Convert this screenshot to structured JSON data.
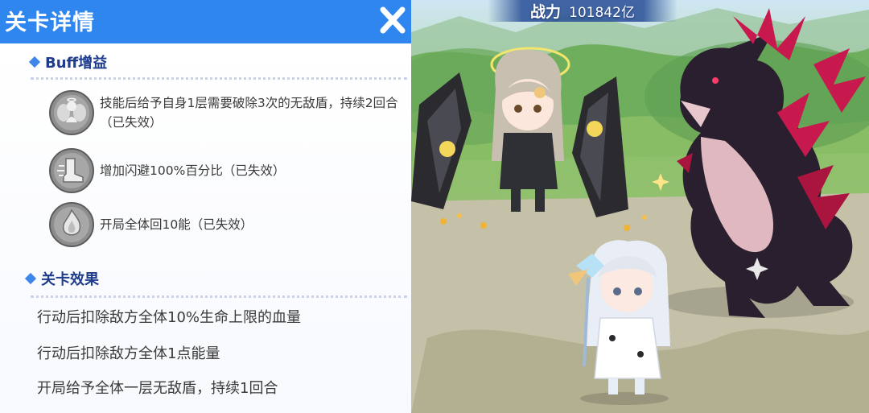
{
  "panel": {
    "title": "关卡详情",
    "buff_section": {
      "title": "Buff增益",
      "items": [
        {
          "icon": "angel-icon",
          "text": "技能后给予自身1层需要破除3次的无敌盾，持续2回合（已失效）"
        },
        {
          "icon": "boot-icon",
          "text": "增加闪避100%百分比（已失效）"
        },
        {
          "icon": "energy-flame-icon",
          "text": "开局全体回10能（已失效）"
        }
      ]
    },
    "effect_section": {
      "title": "关卡效果",
      "items": [
        "行动后扣除敌方全体10%生命上限的血量",
        "行动后扣除敌方全体1点能量",
        "开局给予全体一层无敌盾，持续1回合"
      ]
    }
  },
  "scene": {
    "power_label": "战力",
    "power_value": "101842亿"
  },
  "colors": {
    "header_blue": "#2f86ee",
    "section_title": "#1f3c8c",
    "diamond": "#3f86ea",
    "body_text": "#3a3a3a",
    "dragon_accent": "#c8194e"
  }
}
